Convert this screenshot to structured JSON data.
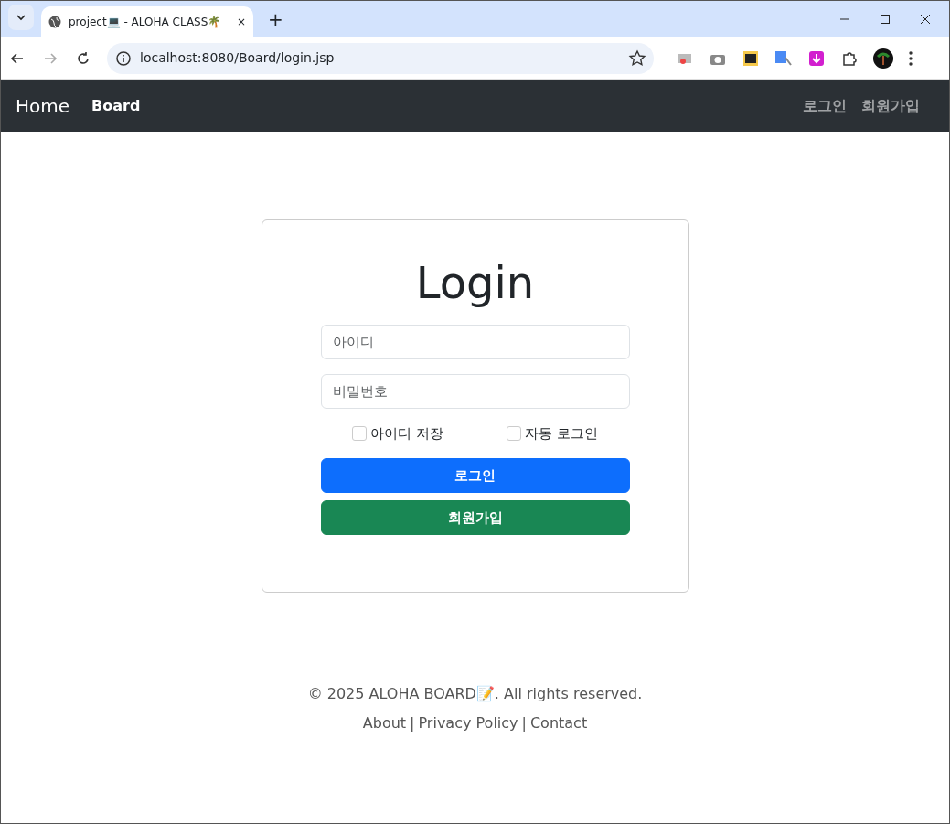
{
  "browser": {
    "tab_title": "project💻 - ALOHA CLASS🌴",
    "tab_close": "×",
    "new_tab": "+",
    "url": "localhost:8080/Board/login.jsp"
  },
  "navbar": {
    "brand": "Home",
    "left_links": [
      {
        "label": "Board"
      }
    ],
    "right_links": [
      {
        "label": "로그인"
      },
      {
        "label": "회원가입"
      }
    ]
  },
  "login": {
    "title": "Login",
    "username_field": {
      "placeholder": "아이디"
    },
    "password_field": {
      "placeholder": "비밀번호"
    },
    "checkboxes": [
      {
        "label": "아이디 저장",
        "checked": false
      },
      {
        "label": "자동 로그인",
        "checked": false
      }
    ],
    "buttons": [
      {
        "label": "로그인",
        "kind": "primary"
      },
      {
        "label": "회원가입",
        "kind": "success"
      }
    ]
  },
  "footer": {
    "copyright": "© 2025 ALOHA BOARD📝. All rights reserved.",
    "links": [
      {
        "label": "About"
      },
      {
        "label": "Privacy Policy"
      },
      {
        "label": "Contact"
      }
    ],
    "separators": [
      "|",
      "|"
    ]
  }
}
